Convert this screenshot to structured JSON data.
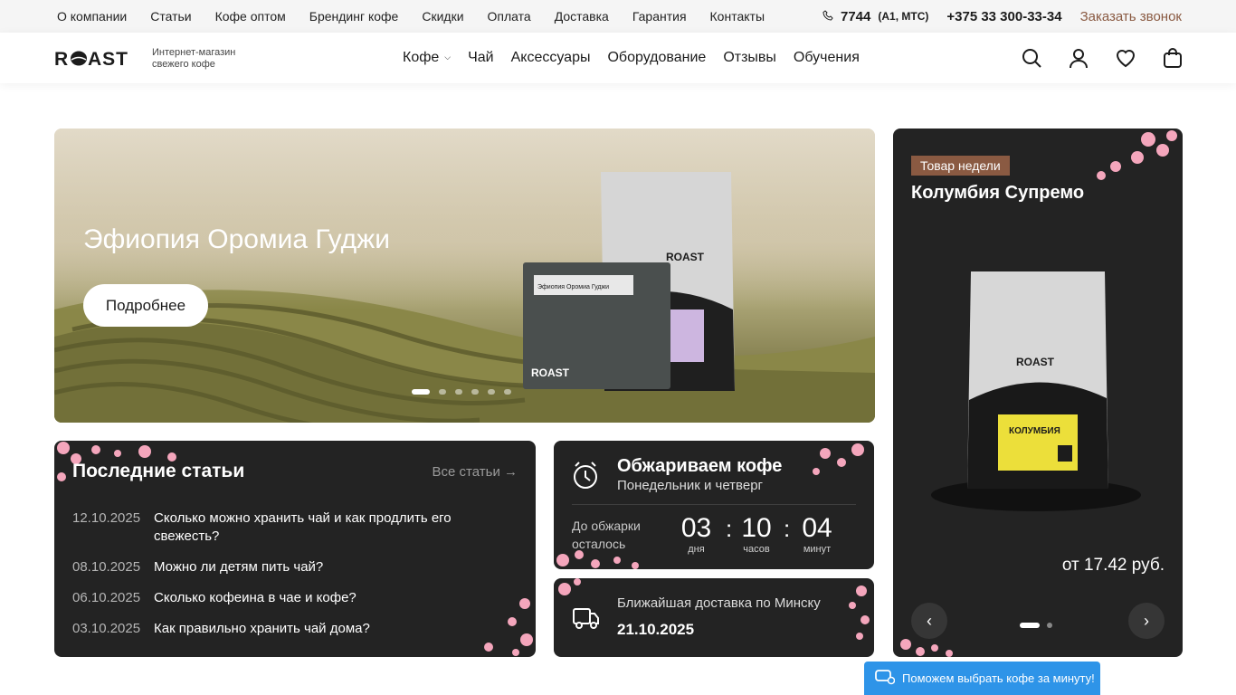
{
  "topbar": {
    "links": [
      "О компании",
      "Статьи",
      "Кофе оптом",
      "Брендинг кофе",
      "Скидки",
      "Оплата",
      "Доставка",
      "Гарантия",
      "Контакты"
    ],
    "phone1": "7744",
    "phone1_note": "(А1, МТС)",
    "phone2": "+375 33 300-33-34",
    "callback": "Заказать звонок"
  },
  "header": {
    "logo_text": "ROAST",
    "logo_tagline_1": "Интернет-магазин",
    "logo_tagline_2": "свежего кофе",
    "nav": [
      "Кофе",
      "Чай",
      "Аксессуары",
      "Оборудование",
      "Отзывы",
      "Обучения"
    ],
    "icons": [
      "search-icon",
      "user-icon",
      "heart-icon",
      "bag-icon"
    ]
  },
  "hero": {
    "title": "Эфиопия Оромиа Гуджи",
    "button": "Подробнее",
    "slides_count": 6,
    "active_slide": 1,
    "package_label": "Эфиопия Оромиа Гуджи",
    "package_brand": "ROAST"
  },
  "week_product": {
    "badge": "Товар недели",
    "title": "Колумбия Супремо",
    "price": "от 17.42 руб.",
    "package_label": "КОЛУМБИЯ",
    "slides_count": 2,
    "active_slide": 1
  },
  "articles": {
    "title": "Последние статьи",
    "all_link": "Все статьи",
    "items": [
      {
        "date": "12.10.2025",
        "title": "Сколько можно хранить чай и как продлить его свежесть?"
      },
      {
        "date": "08.10.2025",
        "title": "Можно ли детям пить чай?"
      },
      {
        "date": "06.10.2025",
        "title": "Сколько кофеина в чае и кофе?"
      },
      {
        "date": "03.10.2025",
        "title": "Как правильно хранить чай дома?"
      }
    ]
  },
  "roasting": {
    "title": "Обжариваем кофе",
    "subtitle": "Понедельник и четверг",
    "countdown_label": "До обжарки осталось",
    "days": "03",
    "days_label": "дня",
    "hours": "10",
    "hours_label": "часов",
    "minutes": "04",
    "minutes_label": "минут"
  },
  "delivery": {
    "label": "Ближайшая доставка по Минску",
    "date": "21.10.2025"
  },
  "help_chip": "Поможем выбрать кофе за минуту!",
  "colors": {
    "accent": "#8a5a42",
    "dark_card": "#232323",
    "help_blue": "#2e94e8"
  }
}
